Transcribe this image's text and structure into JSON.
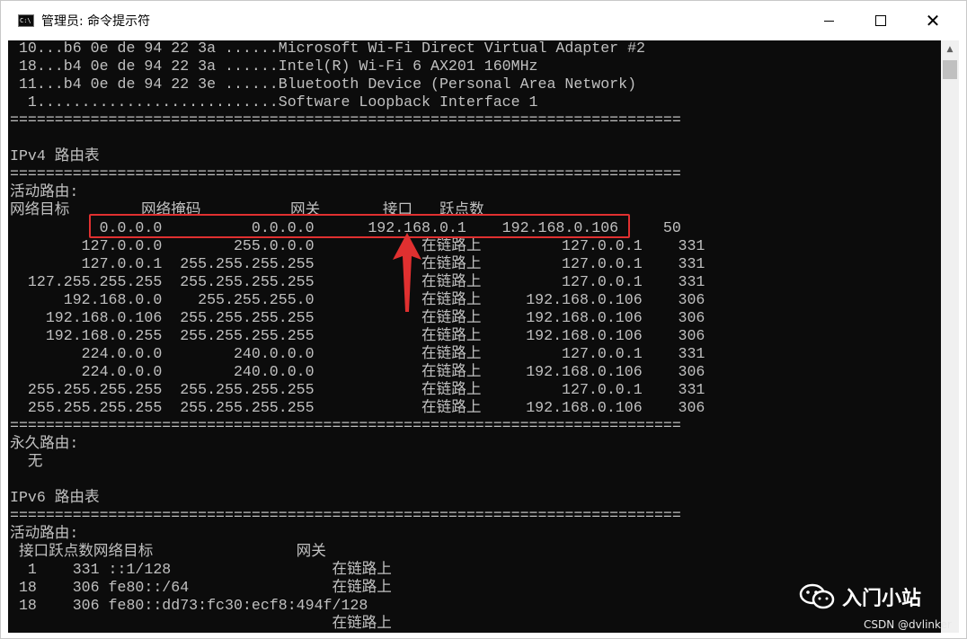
{
  "window": {
    "title": "管理员: 命令提示符",
    "icon_name": "cmd-icon",
    "controls": {
      "minimize_icon": "minimize-icon",
      "maximize_icon": "maximize-icon",
      "close_icon": "close-icon",
      "close_glyph": "✕"
    }
  },
  "console": {
    "background": "#0c0c0c",
    "foreground": "#c0c0c0",
    "lines": [
      " 10...b6 0e de 94 22 3a ......Microsoft Wi-Fi Direct Virtual Adapter #2",
      " 18...b4 0e de 94 22 3a ......Intel(R) Wi-Fi 6 AX201 160MHz",
      " 11...b4 0e de 94 22 3e ......Bluetooth Device (Personal Area Network)",
      "  1...........................Software Loopback Interface 1",
      "===========================================================================",
      "",
      "IPv4 路由表",
      "===========================================================================",
      "活动路由:",
      "网络目标        网络掩码          网关       接口   跃点数",
      "          0.0.0.0          0.0.0.0      192.168.0.1    192.168.0.106     50",
      "        127.0.0.0        255.0.0.0            在链路上         127.0.0.1    331",
      "        127.0.0.1  255.255.255.255            在链路上         127.0.0.1    331",
      "  127.255.255.255  255.255.255.255            在链路上         127.0.0.1    331",
      "      192.168.0.0    255.255.255.0            在链路上     192.168.0.106    306",
      "    192.168.0.106  255.255.255.255            在链路上     192.168.0.106    306",
      "    192.168.0.255  255.255.255.255            在链路上     192.168.0.106    306",
      "        224.0.0.0        240.0.0.0            在链路上         127.0.0.1    331",
      "        224.0.0.0        240.0.0.0            在链路上     192.168.0.106    306",
      "  255.255.255.255  255.255.255.255            在链路上         127.0.0.1    331",
      "  255.255.255.255  255.255.255.255            在链路上     192.168.0.106    306",
      "===========================================================================",
      "永久路由:",
      "  无",
      "",
      "IPv6 路由表",
      "===========================================================================",
      "活动路由:",
      " 接口跃点数网络目标                网关",
      "  1    331 ::1/128                  在链路上",
      " 18    306 fe80::/64                在链路上",
      " 18    306 fe80::dd73:fc30:ecf8:494f/128",
      "                                    在链路上"
    ]
  },
  "annotation": {
    "highlight_color": "#e03030",
    "arrow_color": "#e03030"
  },
  "watermark": {
    "icon_name": "wechat-icon",
    "text": "入门小站",
    "credit": "CSDN @dvlinker"
  },
  "scrollbar": {
    "up_glyph": "▲"
  }
}
